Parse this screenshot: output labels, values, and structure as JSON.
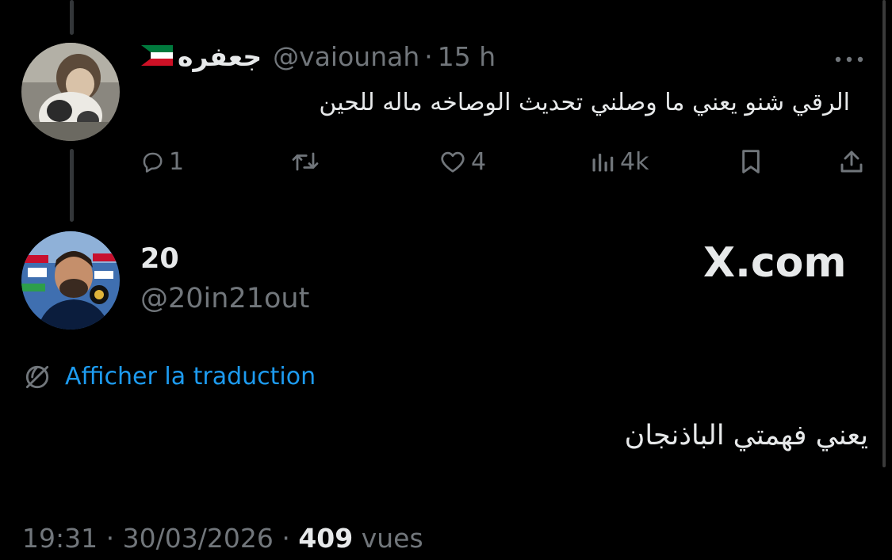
{
  "reply": {
    "display_name": "جعفره",
    "handle": "@vaiounah",
    "time": "15 h",
    "separator": "·",
    "text": "الرقي شنو يعني ما وصلني تحديث الوصاخه ماله للحين",
    "flag_icon": "kuwait-flag-icon",
    "actions": {
      "replies": "1",
      "likes": "4",
      "views": "4k"
    }
  },
  "tweet": {
    "display_name": "20",
    "handle": "@20in21out",
    "watermark": "X.com",
    "translate_label": "Afficher la traduction",
    "text": "يعني فهمتي الباذنجان",
    "time": "19:31",
    "date": "30/03/2026",
    "views_count": "409",
    "views_label": "vues",
    "separator": "·"
  },
  "colors": {
    "background": "#000000",
    "text_primary": "#e7e9ea",
    "text_muted": "#71767b",
    "link": "#1d9bf0",
    "thread_line": "#333639"
  },
  "icons": [
    "more-icon",
    "reply-icon",
    "retweet-icon",
    "like-icon",
    "views-icon",
    "bookmark-icon",
    "share-icon",
    "translate-icon"
  ]
}
